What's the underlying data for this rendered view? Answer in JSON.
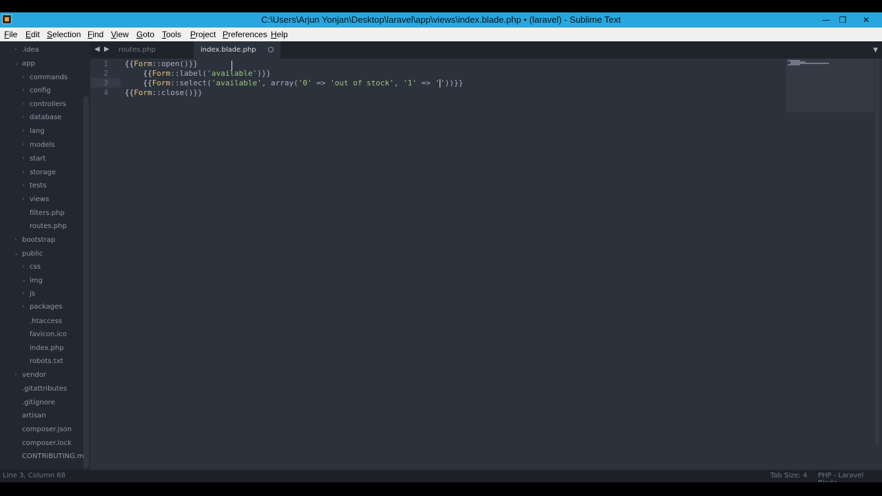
{
  "window": {
    "title": "C:\\Users\\Arjun Yonjan\\Desktop\\laravel\\app\\views\\index.blade.php • (laravel) - Sublime Text",
    "minimize_glyph": "—",
    "restore_glyph": "❐",
    "close_glyph": "✕"
  },
  "menu": [
    "File",
    "Edit",
    "Selection",
    "Find",
    "View",
    "Goto",
    "Tools",
    "Project",
    "Preferences",
    "Help"
  ],
  "sidebar": {
    "items": [
      ".idea",
      "app",
      "commands",
      "config",
      "controllers",
      "database",
      "lang",
      "models",
      "start",
      "storage",
      "tests",
      "views",
      "filters.php",
      "routes.php",
      "bootstrap",
      "public",
      "css",
      "img",
      "js",
      "packages",
      ".htaccess",
      "favicon.ico",
      "index.php",
      "robots.txt",
      "vendor",
      ".gitattributes",
      ".gitignore",
      "artisan",
      "composer.json",
      "composer.lock",
      "CONTRIBUTING.md"
    ]
  },
  "tabs": [
    {
      "label": "routes.php",
      "active": false
    },
    {
      "label": "index.blade.php",
      "active": true
    }
  ],
  "editor": {
    "line_numbers": [
      "1",
      "2",
      "3",
      "4"
    ],
    "line1": {
      "open": "{{",
      "cls": "Form",
      "rest": "::open()}}"
    },
    "line2": {
      "indent": "    ",
      "open": "{{",
      "cls": "Form",
      "mid": "::label(",
      "str": "'available'",
      "close": ")}}"
    },
    "line3": {
      "indent": "    ",
      "open": "{{",
      "cls": "Form",
      "mid": "::select(",
      "str1": "'available'",
      "p1": ", array(",
      "str2": "'0'",
      "arrow1": " => ",
      "str3": "'out of stock'",
      "p2": ", ",
      "str4": "'1'",
      "arrow2": " => ",
      "str5a": "'",
      "str5b": "'",
      "close": "))}}"
    },
    "line4": {
      "open": "{{",
      "cls": "Form",
      "rest": "::close()}}"
    }
  },
  "status": {
    "position": "Line 3, Column 68",
    "tab_size": "Tab Size: 4",
    "syntax": "PHP - Laravel Blade"
  },
  "colors": {
    "titlebar": "#28a7de",
    "editor_bg": "#2c323c",
    "sidebar_bg": "#232830"
  }
}
